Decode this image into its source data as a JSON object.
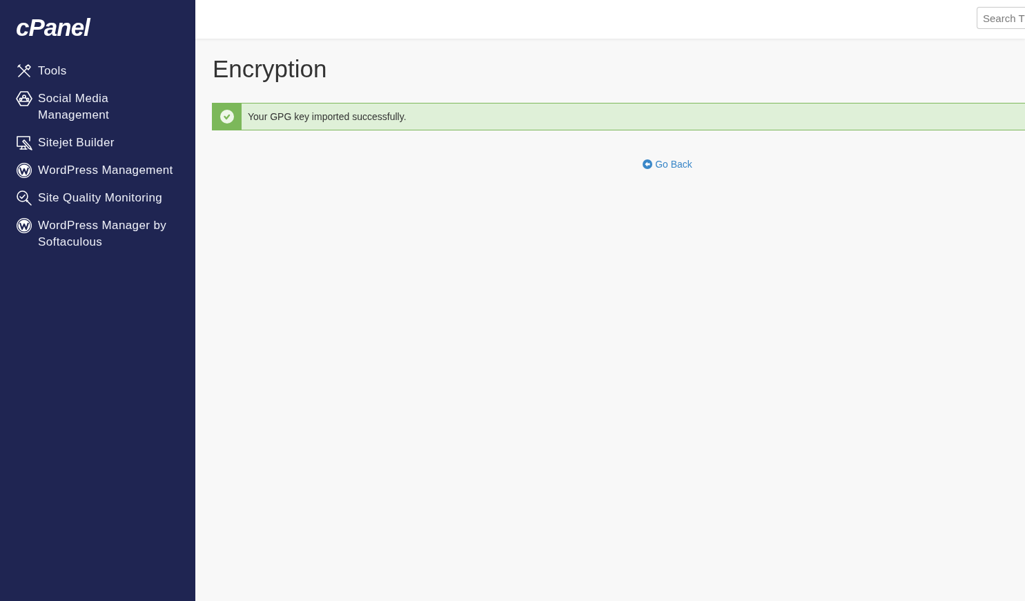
{
  "sidebar": {
    "logo": "cPanel",
    "items": [
      {
        "label": "Tools",
        "selected": false
      },
      {
        "label": "Social Media Management",
        "selected": false
      },
      {
        "label": "Sitejet Builder",
        "selected": false
      },
      {
        "label": "WordPress Management",
        "selected": false
      },
      {
        "label": "Site Quality Monitoring",
        "selected": false
      },
      {
        "label": "WordPress Manager by Softaculous",
        "selected": false
      }
    ]
  },
  "header": {
    "search": {
      "placeholder": "Search T"
    }
  },
  "main": {
    "title": "Encryption",
    "alert": {
      "kind": "success",
      "message": "Your GPG key imported successfully."
    },
    "back_link": "Go Back"
  }
}
